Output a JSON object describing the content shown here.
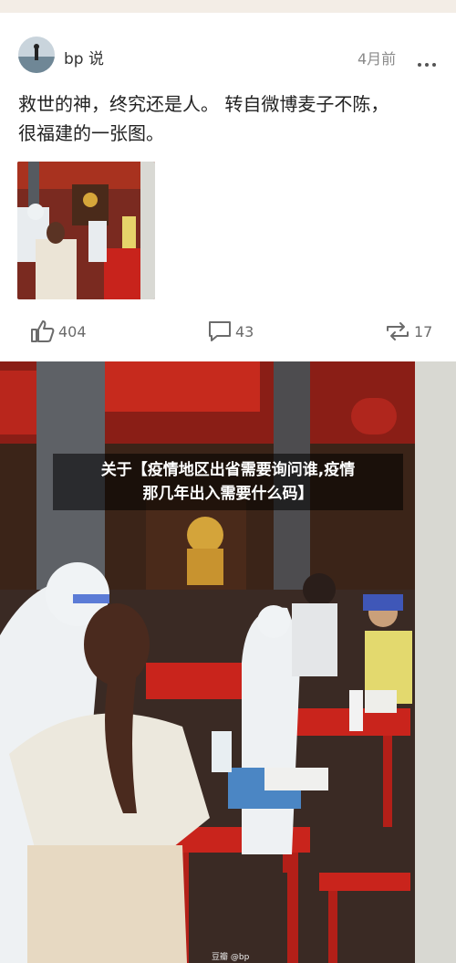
{
  "post": {
    "author": "bp 说",
    "time": "4月前",
    "text_line1": "救世的神，终究还是人。 转自微博麦子不陈，",
    "text_line2": "很福建的一张图。",
    "likes": "404",
    "comments": "43",
    "reposts": "17"
  },
  "headline": {
    "line1": "关于【疫情地区出省需要询问谁,疫情",
    "line2": "那几年出入需要什么码】"
  },
  "watermark": "豆瓣 @bp",
  "icons": [
    "more-icon",
    "like-icon",
    "comment-icon",
    "repost-icon"
  ],
  "colors": {
    "temple_red": "#c7261f",
    "text": "#222222",
    "muted": "#8a8a8a"
  }
}
